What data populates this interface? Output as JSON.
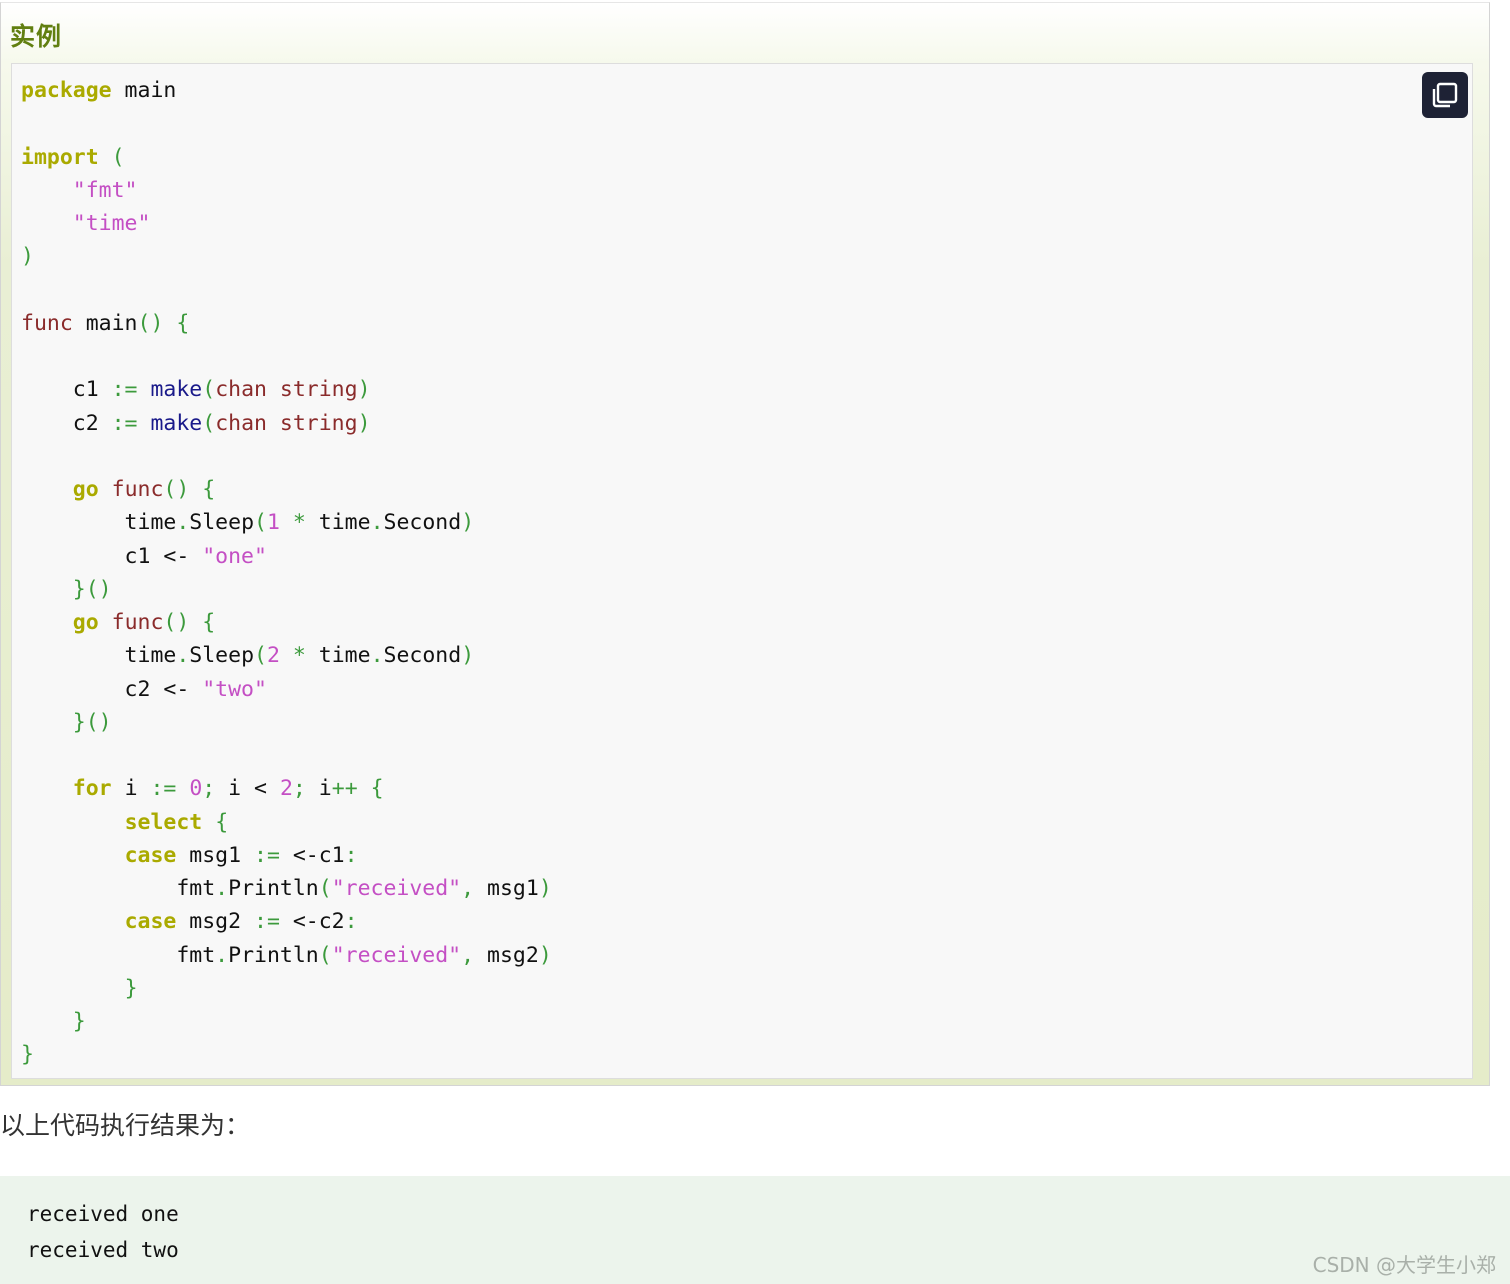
{
  "example": {
    "title": "实例",
    "copy_icon": "copy-icon",
    "code_lines": [
      [
        {
          "c": "kw",
          "t": "package"
        },
        {
          "c": "",
          "t": " main"
        }
      ],
      [],
      [
        {
          "c": "kw",
          "t": "import"
        },
        {
          "c": "",
          "t": " "
        },
        {
          "c": "pn",
          "t": "("
        }
      ],
      [
        {
          "c": "",
          "t": "    "
        },
        {
          "c": "st",
          "t": "\"fmt\""
        }
      ],
      [
        {
          "c": "",
          "t": "    "
        },
        {
          "c": "st",
          "t": "\"time\""
        }
      ],
      [
        {
          "c": "pn",
          "t": ")"
        }
      ],
      [],
      [
        {
          "c": "ty",
          "t": "func"
        },
        {
          "c": "",
          "t": " main"
        },
        {
          "c": "pn",
          "t": "()"
        },
        {
          "c": "",
          "t": " "
        },
        {
          "c": "pn",
          "t": "{"
        }
      ],
      [],
      [
        {
          "c": "",
          "t": "    c1 "
        },
        {
          "c": "pn",
          "t": ":="
        },
        {
          "c": "",
          "t": " "
        },
        {
          "c": "bi",
          "t": "make"
        },
        {
          "c": "pn",
          "t": "("
        },
        {
          "c": "ty",
          "t": "chan string"
        },
        {
          "c": "pn",
          "t": ")"
        }
      ],
      [
        {
          "c": "",
          "t": "    c2 "
        },
        {
          "c": "pn",
          "t": ":="
        },
        {
          "c": "",
          "t": " "
        },
        {
          "c": "bi",
          "t": "make"
        },
        {
          "c": "pn",
          "t": "("
        },
        {
          "c": "ty",
          "t": "chan string"
        },
        {
          "c": "pn",
          "t": ")"
        }
      ],
      [],
      [
        {
          "c": "",
          "t": "    "
        },
        {
          "c": "kw",
          "t": "go"
        },
        {
          "c": "",
          "t": " "
        },
        {
          "c": "ty",
          "t": "func"
        },
        {
          "c": "pn",
          "t": "()"
        },
        {
          "c": "",
          "t": " "
        },
        {
          "c": "pn",
          "t": "{"
        }
      ],
      [
        {
          "c": "",
          "t": "        time"
        },
        {
          "c": "pn",
          "t": "."
        },
        {
          "c": "",
          "t": "Sleep"
        },
        {
          "c": "pn",
          "t": "("
        },
        {
          "c": "nm",
          "t": "1"
        },
        {
          "c": "",
          "t": " "
        },
        {
          "c": "pn",
          "t": "*"
        },
        {
          "c": "",
          "t": " time"
        },
        {
          "c": "pn",
          "t": "."
        },
        {
          "c": "",
          "t": "Second"
        },
        {
          "c": "pn",
          "t": ")"
        }
      ],
      [
        {
          "c": "",
          "t": "        c1 <- "
        },
        {
          "c": "st",
          "t": "\"one\""
        }
      ],
      [
        {
          "c": "",
          "t": "    "
        },
        {
          "c": "pn",
          "t": "}()"
        }
      ],
      [
        {
          "c": "",
          "t": "    "
        },
        {
          "c": "kw",
          "t": "go"
        },
        {
          "c": "",
          "t": " "
        },
        {
          "c": "ty",
          "t": "func"
        },
        {
          "c": "pn",
          "t": "()"
        },
        {
          "c": "",
          "t": " "
        },
        {
          "c": "pn",
          "t": "{"
        }
      ],
      [
        {
          "c": "",
          "t": "        time"
        },
        {
          "c": "pn",
          "t": "."
        },
        {
          "c": "",
          "t": "Sleep"
        },
        {
          "c": "pn",
          "t": "("
        },
        {
          "c": "nm",
          "t": "2"
        },
        {
          "c": "",
          "t": " "
        },
        {
          "c": "pn",
          "t": "*"
        },
        {
          "c": "",
          "t": " time"
        },
        {
          "c": "pn",
          "t": "."
        },
        {
          "c": "",
          "t": "Second"
        },
        {
          "c": "pn",
          "t": ")"
        }
      ],
      [
        {
          "c": "",
          "t": "        c2 <- "
        },
        {
          "c": "st",
          "t": "\"two\""
        }
      ],
      [
        {
          "c": "",
          "t": "    "
        },
        {
          "c": "pn",
          "t": "}()"
        }
      ],
      [],
      [
        {
          "c": "",
          "t": "    "
        },
        {
          "c": "kw",
          "t": "for"
        },
        {
          "c": "",
          "t": " i "
        },
        {
          "c": "pn",
          "t": ":="
        },
        {
          "c": "",
          "t": " "
        },
        {
          "c": "nm",
          "t": "0"
        },
        {
          "c": "pn",
          "t": ";"
        },
        {
          "c": "",
          "t": " i < "
        },
        {
          "c": "nm",
          "t": "2"
        },
        {
          "c": "pn",
          "t": ";"
        },
        {
          "c": "",
          "t": " i"
        },
        {
          "c": "pn",
          "t": "++"
        },
        {
          "c": "",
          "t": " "
        },
        {
          "c": "pn",
          "t": "{"
        }
      ],
      [
        {
          "c": "",
          "t": "        "
        },
        {
          "c": "kw",
          "t": "select"
        },
        {
          "c": "",
          "t": " "
        },
        {
          "c": "pn",
          "t": "{"
        }
      ],
      [
        {
          "c": "",
          "t": "        "
        },
        {
          "c": "kw",
          "t": "case"
        },
        {
          "c": "",
          "t": " msg1 "
        },
        {
          "c": "pn",
          "t": ":="
        },
        {
          "c": "",
          "t": " <-c1"
        },
        {
          "c": "pn",
          "t": ":"
        }
      ],
      [
        {
          "c": "",
          "t": "            fmt"
        },
        {
          "c": "pn",
          "t": "."
        },
        {
          "c": "",
          "t": "Println"
        },
        {
          "c": "pn",
          "t": "("
        },
        {
          "c": "st",
          "t": "\"received\""
        },
        {
          "c": "pn",
          "t": ","
        },
        {
          "c": "",
          "t": " msg1"
        },
        {
          "c": "pn",
          "t": ")"
        }
      ],
      [
        {
          "c": "",
          "t": "        "
        },
        {
          "c": "kw",
          "t": "case"
        },
        {
          "c": "",
          "t": " msg2 "
        },
        {
          "c": "pn",
          "t": ":="
        },
        {
          "c": "",
          "t": " <-c2"
        },
        {
          "c": "pn",
          "t": ":"
        }
      ],
      [
        {
          "c": "",
          "t": "            fmt"
        },
        {
          "c": "pn",
          "t": "."
        },
        {
          "c": "",
          "t": "Println"
        },
        {
          "c": "pn",
          "t": "("
        },
        {
          "c": "st",
          "t": "\"received\""
        },
        {
          "c": "pn",
          "t": ","
        },
        {
          "c": "",
          "t": " msg2"
        },
        {
          "c": "pn",
          "t": ")"
        }
      ],
      [
        {
          "c": "",
          "t": "        "
        },
        {
          "c": "pn",
          "t": "}"
        }
      ],
      [
        {
          "c": "",
          "t": "    "
        },
        {
          "c": "pn",
          "t": "}"
        }
      ],
      [
        {
          "c": "pn",
          "t": "}"
        }
      ]
    ]
  },
  "result_label": "以上代码执行结果为：",
  "output_lines": [
    "received one",
    "received two"
  ],
  "watermark": "CSDN @大学生小郑"
}
